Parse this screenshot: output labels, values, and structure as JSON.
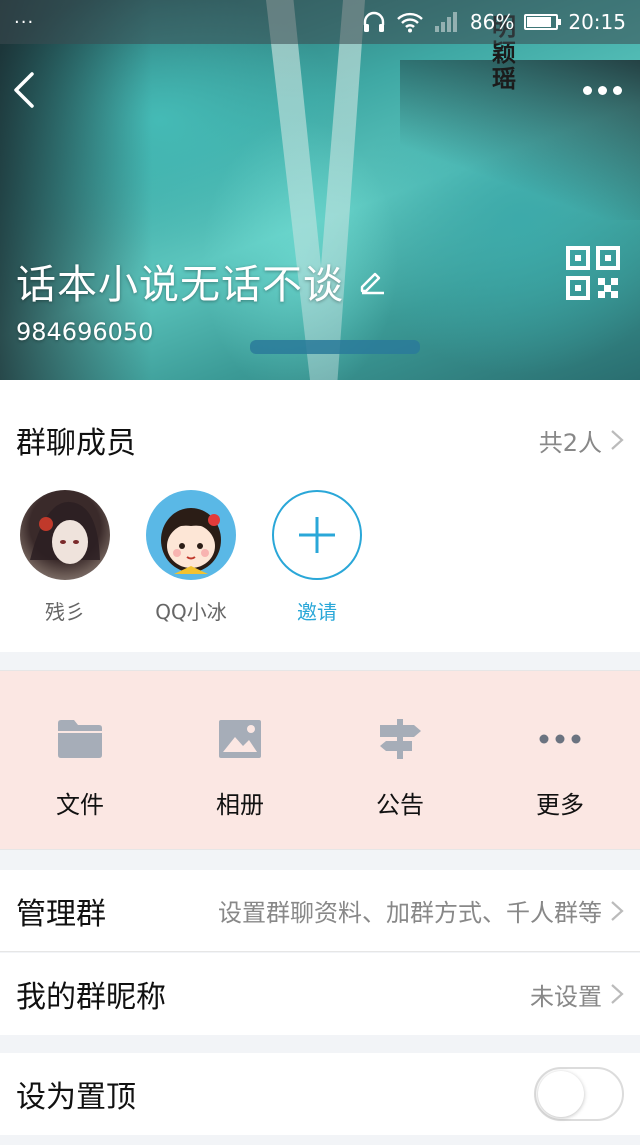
{
  "status_bar": {
    "dots": "···",
    "battery": "86%",
    "time": "20:15",
    "battery_level": 0.86
  },
  "header": {
    "calligraphy": "明\n颖\n瑶",
    "group_name": "话本小说无话不谈",
    "group_id": "984696050"
  },
  "members": {
    "title": "群聊成员",
    "count": "共2人",
    "list": [
      {
        "name": "残彡"
      },
      {
        "name": "QQ小冰"
      }
    ],
    "invite_label": "邀请"
  },
  "features": [
    {
      "label": "文件",
      "icon": "folder-icon"
    },
    {
      "label": "相册",
      "icon": "album-icon"
    },
    {
      "label": "公告",
      "icon": "signpost-icon"
    },
    {
      "label": "更多",
      "icon": "more-dots-icon"
    }
  ],
  "rows": {
    "manage": {
      "label": "管理群",
      "value": "设置群聊资料、加群方式、千人群等"
    },
    "nickname": {
      "label": "我的群昵称",
      "value": "未设置"
    },
    "pin": {
      "label": "设为置顶",
      "on": false
    }
  },
  "colors": {
    "accent": "#2aa7d8",
    "feature_bg": "#fbe7e3",
    "icon_gray": "#a6adb8"
  }
}
